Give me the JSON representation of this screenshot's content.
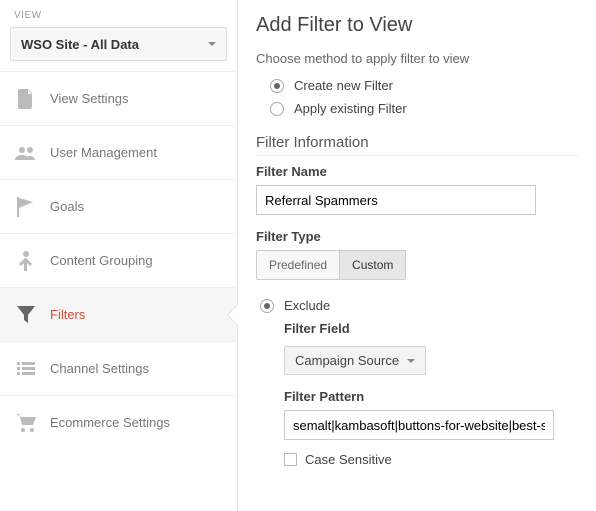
{
  "sidebar": {
    "view_label": "VIEW",
    "view_selected": "WSO Site - All Data",
    "items": [
      {
        "label": "View Settings"
      },
      {
        "label": "User Management"
      },
      {
        "label": "Goals"
      },
      {
        "label": "Content Grouping"
      },
      {
        "label": "Filters"
      },
      {
        "label": "Channel Settings"
      },
      {
        "label": "Ecommerce Settings"
      }
    ]
  },
  "main": {
    "title": "Add Filter to View",
    "method_label": "Choose method to apply filter to view",
    "method_options": {
      "create": "Create new Filter",
      "apply": "Apply existing Filter"
    },
    "filter_info_heading": "Filter Information",
    "filter_name_label": "Filter Name",
    "filter_name_value": "Referral Spammers",
    "filter_type_label": "Filter Type",
    "type_predefined": "Predefined",
    "type_custom": "Custom",
    "exclude_label": "Exclude",
    "filter_field_label": "Filter Field",
    "filter_field_value": "Campaign Source",
    "filter_pattern_label": "Filter Pattern",
    "filter_pattern_value": "semalt|kambasoft|buttons-for-website|best-se",
    "case_sensitive_label": "Case Sensitive"
  }
}
